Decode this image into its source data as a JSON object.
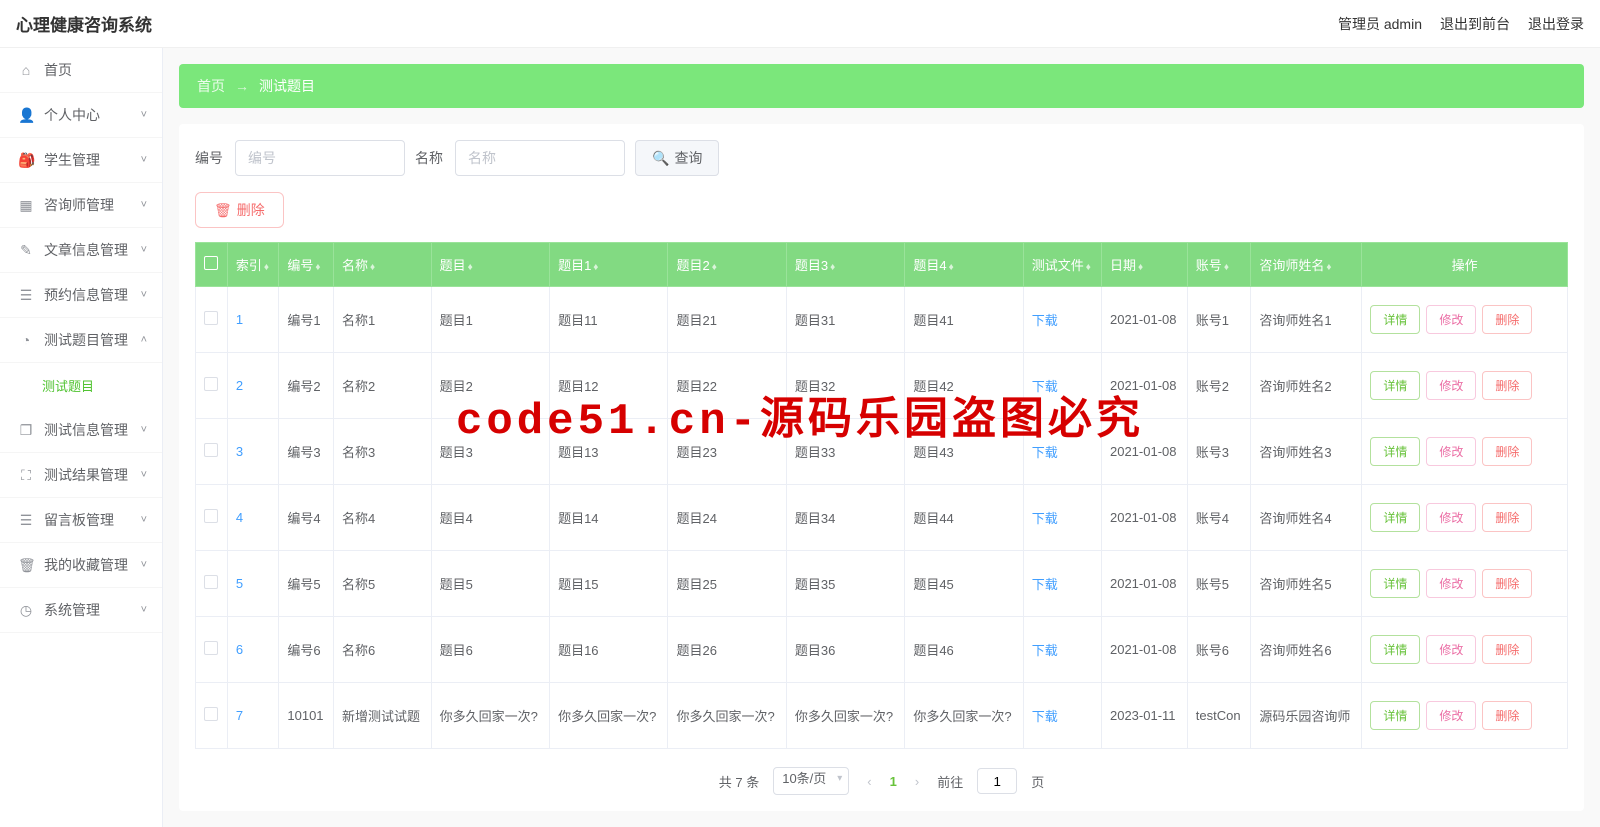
{
  "app_title": "心理健康咨询系统",
  "header": {
    "admin_label": "管理员 admin",
    "exit_front": "退出到前台",
    "logout": "退出登录"
  },
  "sidebar": {
    "items": [
      {
        "icon": "⌂",
        "label": "首页",
        "expandable": false
      },
      {
        "icon": "👤",
        "label": "个人中心",
        "expandable": true
      },
      {
        "icon": "🎒",
        "label": "学生管理",
        "expandable": true
      },
      {
        "icon": "▦",
        "label": "咨询师管理",
        "expandable": true
      },
      {
        "icon": "✎",
        "label": "文章信息管理",
        "expandable": true
      },
      {
        "icon": "☰",
        "label": "预约信息管理",
        "expandable": true
      },
      {
        "icon": "◔",
        "label": "测试题目管理",
        "expandable": true,
        "expanded": true,
        "children": [
          {
            "label": "测试题目"
          }
        ]
      },
      {
        "icon": "❐",
        "label": "测试信息管理",
        "expandable": true
      },
      {
        "icon": "⛶",
        "label": "测试结果管理",
        "expandable": true
      },
      {
        "icon": "☰",
        "label": "留言板管理",
        "expandable": true
      },
      {
        "icon": "🗑",
        "label": "我的收藏管理",
        "expandable": true
      },
      {
        "icon": "◷",
        "label": "系统管理",
        "expandable": true
      }
    ]
  },
  "breadcrumb": {
    "home": "首页",
    "current": "测试题目"
  },
  "filters": {
    "code_label": "编号",
    "code_ph": "编号",
    "name_label": "名称",
    "name_ph": "名称",
    "search_label": "查询"
  },
  "top_delete": "删除",
  "table": {
    "headers": [
      "",
      "索引",
      "编号",
      "名称",
      "题目",
      "题目1",
      "题目2",
      "题目3",
      "题目4",
      "测试文件",
      "日期",
      "账号",
      "咨询师姓名",
      "操作"
    ],
    "download_label": "下载",
    "ops": {
      "detail": "详情",
      "edit": "修改",
      "del": "删除"
    },
    "rows": [
      {
        "idx": "1",
        "code": "编号1",
        "name": "名称1",
        "t0": "题目1",
        "t1": "题目11",
        "t2": "题目21",
        "t3": "题目31",
        "t4": "题目41",
        "date": "2021-01-08",
        "acct": "账号1",
        "counselor": "咨询师姓名1"
      },
      {
        "idx": "2",
        "code": "编号2",
        "name": "名称2",
        "t0": "题目2",
        "t1": "题目12",
        "t2": "题目22",
        "t3": "题目32",
        "t4": "题目42",
        "date": "2021-01-08",
        "acct": "账号2",
        "counselor": "咨询师姓名2"
      },
      {
        "idx": "3",
        "code": "编号3",
        "name": "名称3",
        "t0": "题目3",
        "t1": "题目13",
        "t2": "题目23",
        "t3": "题目33",
        "t4": "题目43",
        "date": "2021-01-08",
        "acct": "账号3",
        "counselor": "咨询师姓名3"
      },
      {
        "idx": "4",
        "code": "编号4",
        "name": "名称4",
        "t0": "题目4",
        "t1": "题目14",
        "t2": "题目24",
        "t3": "题目34",
        "t4": "题目44",
        "date": "2021-01-08",
        "acct": "账号4",
        "counselor": "咨询师姓名4"
      },
      {
        "idx": "5",
        "code": "编号5",
        "name": "名称5",
        "t0": "题目5",
        "t1": "题目15",
        "t2": "题目25",
        "t3": "题目35",
        "t4": "题目45",
        "date": "2021-01-08",
        "acct": "账号5",
        "counselor": "咨询师姓名5"
      },
      {
        "idx": "6",
        "code": "编号6",
        "name": "名称6",
        "t0": "题目6",
        "t1": "题目16",
        "t2": "题目26",
        "t3": "题目36",
        "t4": "题目46",
        "date": "2021-01-08",
        "acct": "账号6",
        "counselor": "咨询师姓名6"
      },
      {
        "idx": "7",
        "code": "10101",
        "name": "新增测试试题",
        "t0": "你多久回家一次?",
        "t1": "你多久回家一次?",
        "t2": "你多久回家一次?",
        "t3": "你多久回家一次?",
        "t4": "你多久回家一次?",
        "date": "2023-01-11",
        "acct": "testCon",
        "counselor": "源码乐园咨询师"
      }
    ]
  },
  "pagination": {
    "total_label": "共 7 条",
    "page_size": "10条/页",
    "current": "1",
    "goto_prefix": "前往",
    "goto_suffix": "页",
    "goto_value": "1"
  },
  "watermark": "code51.cn-源码乐园盗图必究"
}
